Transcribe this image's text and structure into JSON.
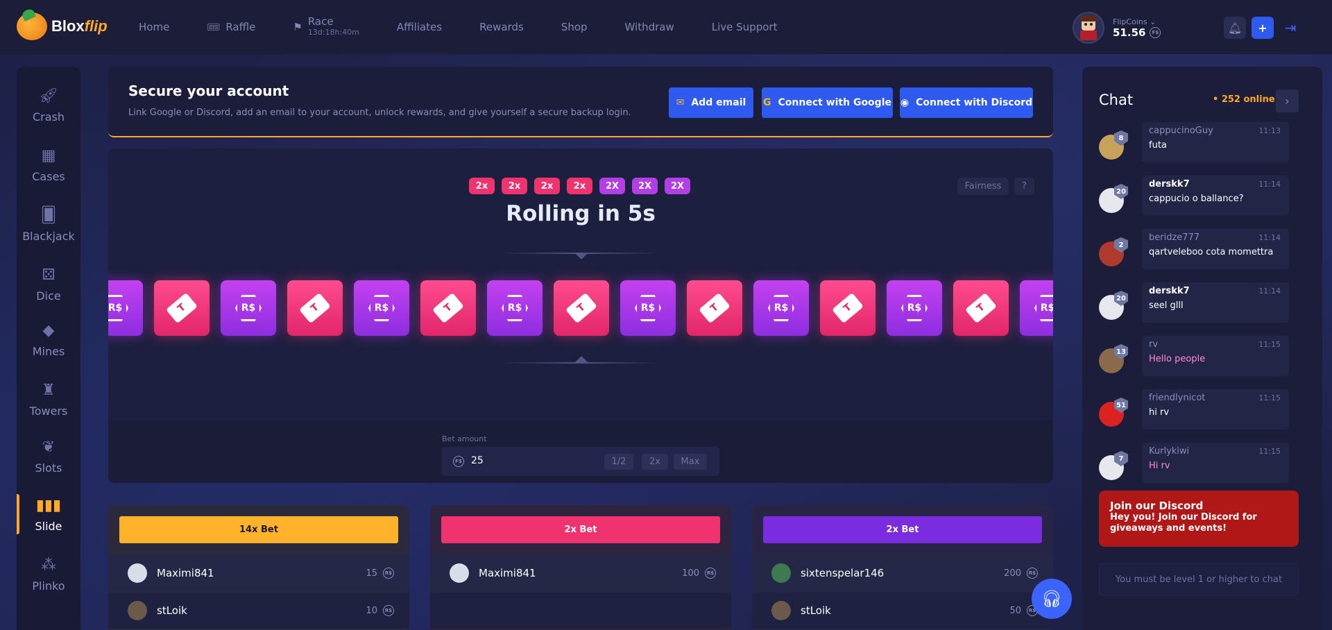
{
  "brand": {
    "name_main": "Blox",
    "name_accent": "flip"
  },
  "nav": {
    "home": "Home",
    "raffle": "Raffle",
    "race": "Race",
    "race_timer": "13d:18h:40m",
    "affiliates": "Affiliates",
    "rewards": "Rewards",
    "shop": "Shop",
    "withdraw": "Withdraw",
    "live_support": "Live Support"
  },
  "user": {
    "currency_label": "FlipCoins",
    "balance": "51.56",
    "coin_symbol": "F$"
  },
  "sidebar": {
    "items": [
      {
        "label": "Crash",
        "icon": "rocket-icon"
      },
      {
        "label": "Cases",
        "icon": "cases-icon"
      },
      {
        "label": "Blackjack",
        "icon": "cards-icon"
      },
      {
        "label": "Dice",
        "icon": "dice-icon"
      },
      {
        "label": "Mines",
        "icon": "diamond-icon"
      },
      {
        "label": "Towers",
        "icon": "tower-icon"
      },
      {
        "label": "Slots",
        "icon": "cherry-icon"
      },
      {
        "label": "Slide",
        "icon": "slide-icon"
      },
      {
        "label": "Plinko",
        "icon": "plinko-icon"
      }
    ],
    "active": "Slide"
  },
  "secure": {
    "title": "Secure your account",
    "desc": "Link Google or Discord, add an email to your account, unlock rewards, and give yourself a secure backup login.",
    "add_email": "Add email",
    "google": "Connect with Google",
    "discord": "Connect with Discord"
  },
  "game": {
    "history": [
      {
        "label": "2x",
        "color": "#f0326f"
      },
      {
        "label": "2x",
        "color": "#f0326f"
      },
      {
        "label": "2x",
        "color": "#f0326f"
      },
      {
        "label": "2x",
        "color": "#f0326f"
      },
      {
        "label": "2X",
        "color": "#b23fe6"
      },
      {
        "label": "2X",
        "color": "#b23fe6"
      },
      {
        "label": "2X",
        "color": "#b23fe6"
      }
    ],
    "fairness": "Fairness",
    "help": "?",
    "status": "Rolling in 5s",
    "reel": [
      "robux",
      "ticket",
      "robux",
      "ticket",
      "robux",
      "ticket",
      "robux",
      "ticket",
      "robux",
      "ticket",
      "robux",
      "ticket",
      "robux",
      "ticket",
      "robux"
    ],
    "ticket_glyph": "T",
    "robux_glyph": "R$"
  },
  "bet": {
    "label": "Bet amount",
    "value": "25",
    "half": "1/2",
    "double": "2x",
    "max": "Max"
  },
  "columns": [
    {
      "title": "14x Bet",
      "color": "#ffb22a",
      "text": "#1a1a2e",
      "players": [
        {
          "name": "Maximi841",
          "amount": "15"
        },
        {
          "name": "stLoik",
          "amount": "10"
        }
      ]
    },
    {
      "title": "2x Bet",
      "color": "#f0326f",
      "text": "#ffffff",
      "players": [
        {
          "name": "Maximi841",
          "amount": "100"
        }
      ]
    },
    {
      "title": "2x Bet",
      "color": "#7b2be0",
      "text": "#ffffff",
      "players": [
        {
          "name": "sixtenspelar146",
          "amount": "200"
        },
        {
          "name": "stLoik",
          "amount": "50"
        }
      ]
    }
  ],
  "chat": {
    "title": "Chat",
    "online": "• 252 online",
    "arrow": "›",
    "messages": [
      {
        "user": "cappucinoGuy",
        "time": "11:13",
        "text": "futa",
        "level": "8",
        "strong": false,
        "pink": false
      },
      {
        "user": "derskk7",
        "time": "11:14",
        "text": "cappucio o ballance?",
        "level": "20",
        "strong": true,
        "pink": false
      },
      {
        "user": "beridze777",
        "time": "11:14",
        "text": "qartveleboo cota momettra",
        "level": "2",
        "strong": false,
        "pink": false
      },
      {
        "user": "derskk7",
        "time": "11:14",
        "text": "seel glll",
        "level": "20",
        "strong": true,
        "pink": false
      },
      {
        "user": "rv",
        "time": "11:15",
        "text": "Hello people",
        "level": "13",
        "strong": false,
        "pink": true
      },
      {
        "user": "friendlynicot",
        "time": "11:15",
        "text": "hi rv",
        "level": "51",
        "strong": false,
        "pink": false
      },
      {
        "user": "Kurlykiwi",
        "time": "11:15",
        "text": "Hi rv",
        "level": "7",
        "strong": false,
        "pink": true
      }
    ],
    "discord_title": "Join our Discord",
    "discord_text": "Hey you! Join our Discord for giveaways and events!",
    "input_placeholder": "You must be level 1 or higher to chat"
  }
}
